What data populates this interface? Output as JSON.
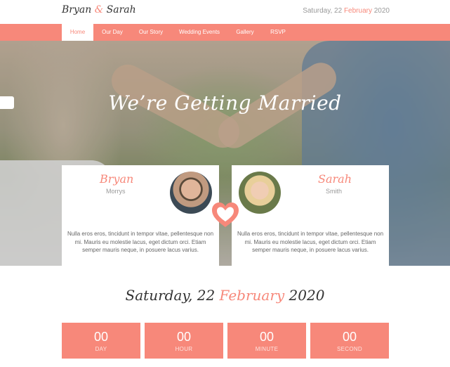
{
  "header": {
    "logo_first": "Bryan",
    "logo_amp": "&",
    "logo_second": "Sarah",
    "date_prefix": "Saturday, 22",
    "date_month": "February",
    "date_year": "2020"
  },
  "nav": {
    "items": [
      "Home",
      "Our Day",
      "Our Story",
      "Wedding Events",
      "Gallery",
      "RSVP"
    ],
    "active": "Home"
  },
  "hero": {
    "title": "We’re Getting Married"
  },
  "couple": {
    "groom": {
      "name": "Bryan",
      "surname": "Morrys",
      "bio": "Nulla eros eros, tincidunt in tempor vitae, pellentesque non mi. Mauris eu molestie lacus, eget dictum orci. Etiam semper mauris neque, in posuere lacus varius."
    },
    "bride": {
      "name": "Sarah",
      "surname": "Smith",
      "bio": "Nulla eros eros, tincidunt in tempor vitae, pellentesque non mi. Mauris eu molestie lacus, eget dictum orci. Etiam semper mauris neque, in posuere lacus varius."
    }
  },
  "countdown": {
    "date_prefix": "Saturday, 22",
    "date_month": "February",
    "date_year": "2020",
    "units": [
      {
        "value": "00",
        "label": "DAY"
      },
      {
        "value": "00",
        "label": "HOUR"
      },
      {
        "value": "00",
        "label": "MINUTE"
      },
      {
        "value": "00",
        "label": "SECOND"
      }
    ]
  },
  "colors": {
    "accent": "#f7887a",
    "text_dark": "#333333",
    "text_muted": "#999999"
  },
  "icons": {
    "heart": "heart-icon"
  }
}
